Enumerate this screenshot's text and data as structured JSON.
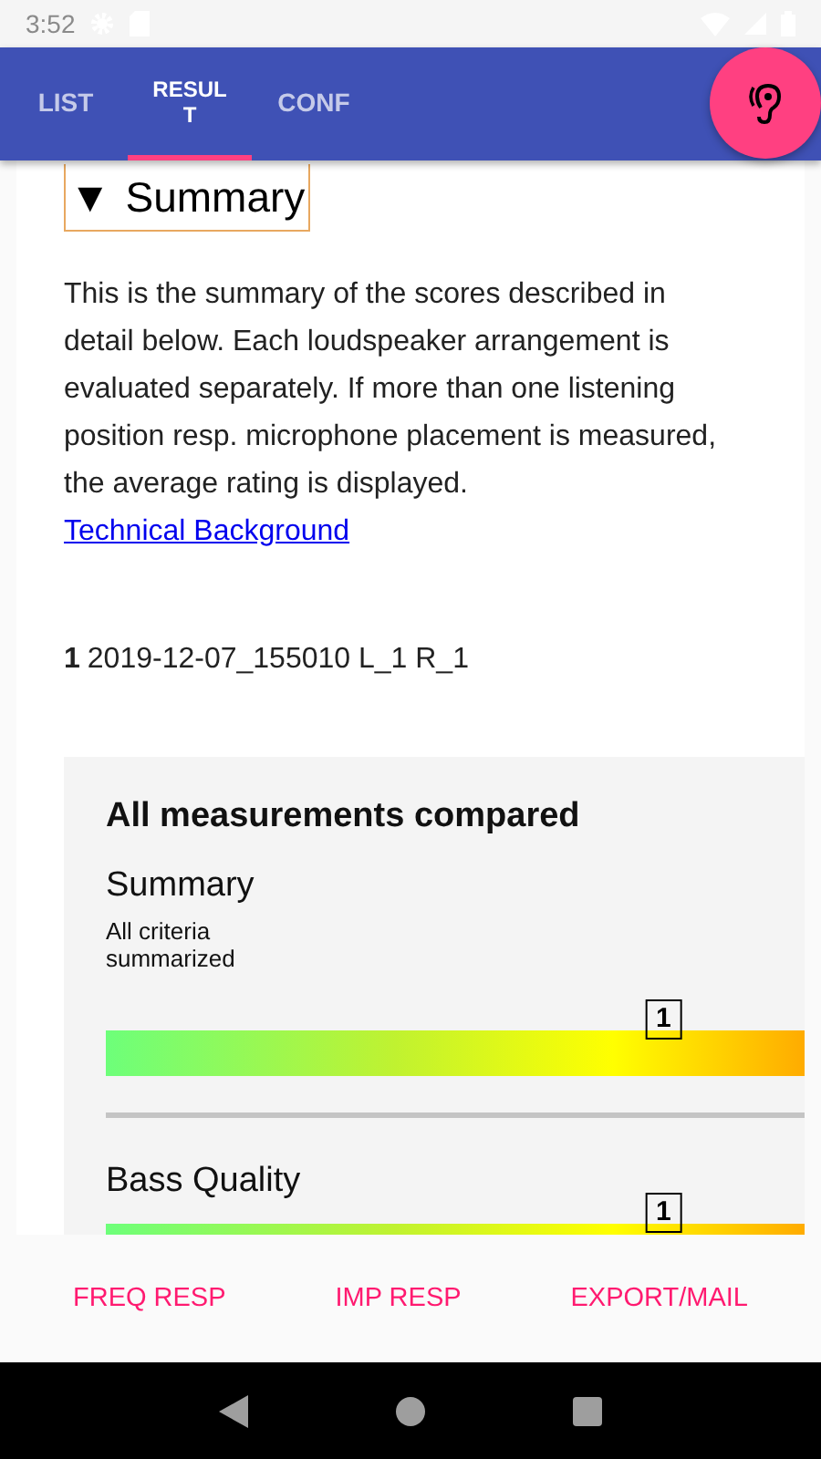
{
  "status_bar": {
    "time": "3:52"
  },
  "tabs": [
    {
      "label": "LIST",
      "selected": false
    },
    {
      "label": "RESULT",
      "selected": true
    },
    {
      "label": "CONF",
      "selected": false
    }
  ],
  "section": {
    "toggle": "▼",
    "title": "Summary",
    "expanded": true
  },
  "description": "This is the summary of the scores described in detail below. Each loudspeaker arrangement is evaluated separately. If more than one listening position resp. microphone placement is measured, the average rating is displayed.",
  "link": "Technical Background",
  "measurements": [
    {
      "index": "1",
      "name": "2019-12-07_155010 L_1 R_1"
    }
  ],
  "comparison": {
    "title": "All measurements compared",
    "criteria": [
      {
        "name": "Summary",
        "note": "All criteria summarized",
        "marker": "1",
        "level": 0.77
      },
      {
        "name": "Bass Quality",
        "marker": "1",
        "level": 0.77
      }
    ]
  },
  "actions": [
    "FREQ RESP",
    "IMP RESP",
    "EXPORT/MAIL"
  ]
}
